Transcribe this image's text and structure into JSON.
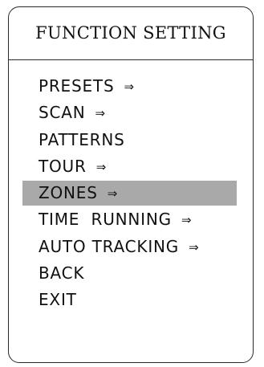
{
  "menu": {
    "title": "FUNCTION SETTING",
    "items": [
      {
        "label": "PRESETS",
        "arrow": "⇒",
        "selected": false
      },
      {
        "label": "SCAN",
        "arrow": "⇒",
        "selected": false
      },
      {
        "label": "PATTERNS",
        "arrow": "",
        "selected": false
      },
      {
        "label": "TOUR",
        "arrow": "⇒",
        "selected": false
      },
      {
        "label": "ZONES",
        "arrow": "⇒",
        "selected": true
      },
      {
        "label": "TIME  RUNNING",
        "arrow": "⇒",
        "selected": false
      },
      {
        "label": "AUTO TRACKING",
        "arrow": "⇒",
        "selected": false
      },
      {
        "label": "BACK",
        "arrow": "",
        "selected": false
      },
      {
        "label": "EXIT",
        "arrow": "",
        "selected": false
      }
    ]
  },
  "colors": {
    "highlight": "#a9a9a9",
    "border": "#2a2a2a",
    "text": "#111111",
    "background": "#ffffff"
  },
  "icons": {
    "submenu_arrow": "double-right-arrow-icon"
  }
}
